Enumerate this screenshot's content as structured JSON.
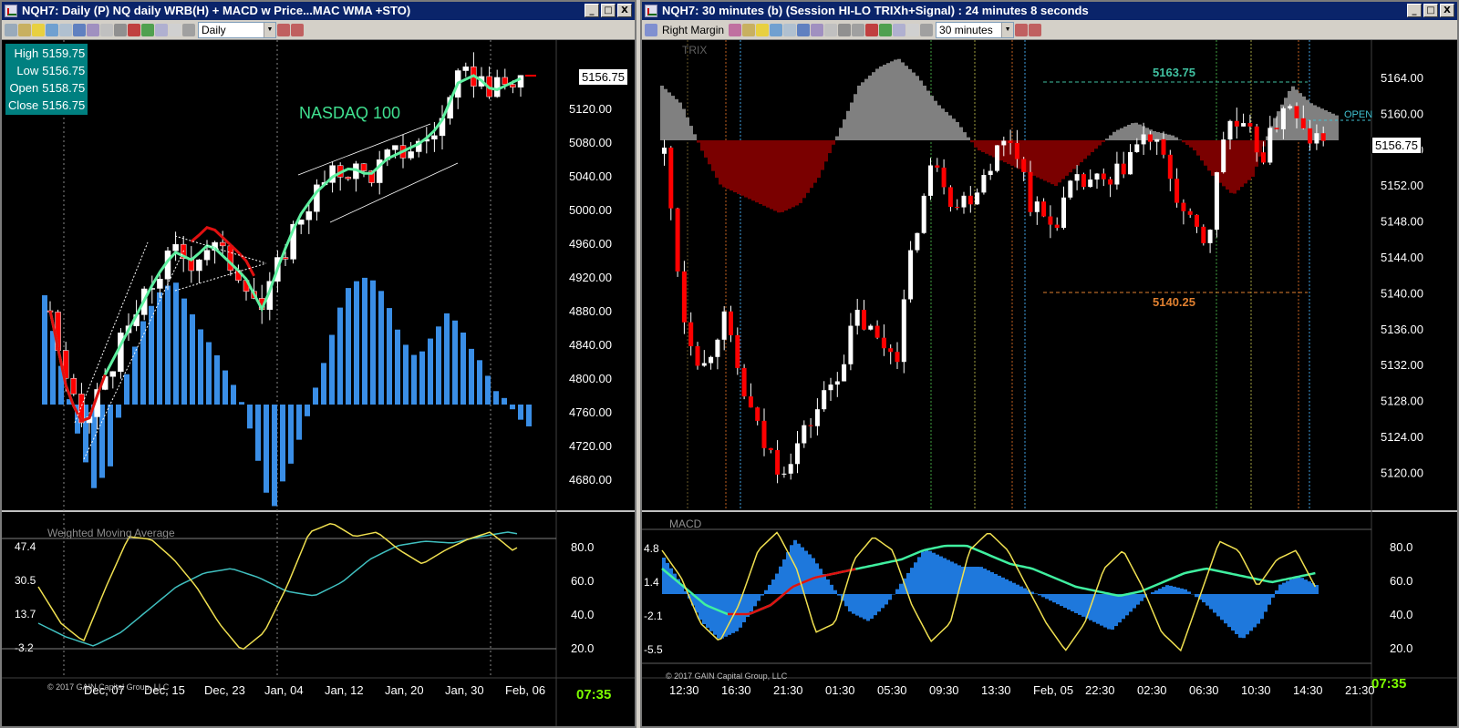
{
  "left": {
    "title": "NQH7: Daily (P)  NQ daily WRB(H) + MACD w Price...MAC WMA +STO)",
    "window_buttons": [
      "_",
      "□",
      "X"
    ],
    "period": "Daily",
    "ohlc": {
      "high_label": "High",
      "high": "5159.75",
      "low_label": "Low",
      "low": "5156.75",
      "open_label": "Open",
      "open": "5158.75",
      "close_label": "Close",
      "close": "5156.75"
    },
    "instrument_label": "NASDAQ 100",
    "price_box": "5156.75",
    "price_ticks": [
      "5120.00",
      "5080.00",
      "5040.00",
      "5000.00",
      "4960.00",
      "4920.00",
      "4880.00",
      "4840.00",
      "4800.00",
      "4760.00",
      "4720.00",
      "4680.00"
    ],
    "indicator_label": "Weighted Moving Average",
    "ind_left_ticks": [
      "47.4",
      "30.5",
      "13.7",
      "-3.2"
    ],
    "ind_right_ticks": [
      "80.0",
      "60.0",
      "40.0",
      "20.0"
    ],
    "copyright": "© 2017 GAIN Capital Group, LLC",
    "date_ticks": [
      "Dec, 07",
      "Dec, 15",
      "Dec, 23",
      "Jan, 04",
      "Jan, 12",
      "Jan, 20",
      "Jan, 30",
      "Feb, 06"
    ],
    "clock": "07:35",
    "colors": {
      "bull": "#ffffff",
      "bear": "#ff0000",
      "hist": "#3a8ee6",
      "wma_up": "#5ef0a0",
      "wma_dn": "#e01010",
      "stoch": "#f0e050",
      "macd": "#40c0c0"
    }
  },
  "right": {
    "title": "NQH7: 30 minutes (b) (Session HI-LO TRIXh+Signal) : 24 minutes 8 seconds",
    "window_buttons": [
      "_",
      "□",
      "X"
    ],
    "margin_label": "Right Margin",
    "period": "30 minutes",
    "trix_label": "TRIX",
    "session_high": "5163.75",
    "session_low": "5140.25",
    "open_label": "OPEN",
    "price_box": "5156.75",
    "price_ticks": [
      "5164.00",
      "5160.00",
      "5156.00",
      "5152.00",
      "5148.00",
      "5144.00",
      "5140.00",
      "5136.00",
      "5132.00",
      "5128.00",
      "5124.00",
      "5120.00"
    ],
    "indicator_label": "MACD",
    "ind_left_ticks": [
      "4.8",
      "1.4",
      "-2.1",
      "-5.5"
    ],
    "ind_right_ticks": [
      "80.0",
      "60.0",
      "40.0",
      "20.0"
    ],
    "copyright": "© 2017 GAIN Capital Group, LLC",
    "time_ticks": [
      "12:30",
      "16:30",
      "21:30",
      "01:30",
      "05:30",
      "09:30",
      "13:30",
      "Feb, 05",
      "22:30",
      "02:30",
      "06:30",
      "10:30",
      "14:30",
      "21:30"
    ],
    "clock": "07:35",
    "colors": {
      "bull": "#ffffff",
      "bear": "#ff0000",
      "trix_pos": "#808080",
      "trix_neg": "#7a0000",
      "high_line": "#40c0a0",
      "low_line": "#e08030",
      "open_line": "#40c0d0"
    }
  }
}
